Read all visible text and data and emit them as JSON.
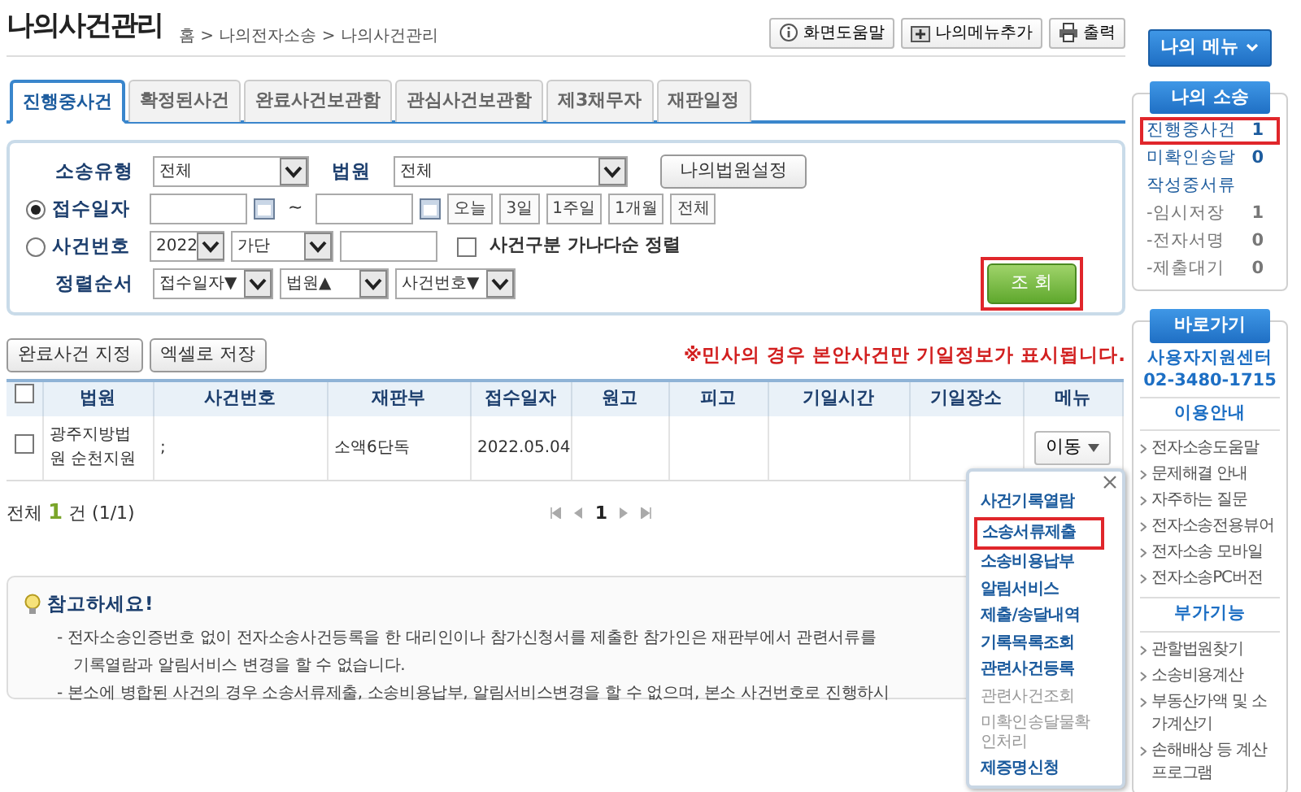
{
  "page": {
    "title": "나의사건관리",
    "breadcrumb": "홈 > 나의전자소송 > 나의사건관리"
  },
  "header_buttons": [
    {
      "kind": "info",
      "label": "화면도움말"
    },
    {
      "kind": "menu-add",
      "label": "나의메뉴추가"
    },
    {
      "kind": "print",
      "label": "출력"
    }
  ],
  "tabs": [
    {
      "label": "진행중사건",
      "selected": true
    },
    {
      "label": "확정된사건",
      "selected": false
    },
    {
      "label": "완료사건보관함",
      "selected": false
    },
    {
      "label": "관심사건보관함",
      "selected": false
    },
    {
      "label": "제3채무자",
      "selected": false
    },
    {
      "label": "재판일정",
      "selected": false
    }
  ],
  "search": {
    "case_type": {
      "label": "소송유형",
      "value": "전체"
    },
    "court": {
      "label": "법원",
      "value": "전체"
    },
    "court_button": "나의법원설정",
    "date_filter": {
      "label": "접수일자",
      "selected": true,
      "separator": "~",
      "quick_buttons": [
        "오늘",
        "3일",
        "1주일",
        "1개월",
        "전체"
      ]
    },
    "case_number_filter": {
      "label": "사건번호",
      "selected": false,
      "year": "2022",
      "case_code": "가단"
    },
    "sort_checkbox": {
      "label": "사건구분 가나다순 정렬",
      "checked": false
    },
    "sort": {
      "label": "정렬순서",
      "options": [
        "접수일자▼",
        "법원▲",
        "사건번호▼"
      ]
    },
    "submit": {
      "label": "조 회",
      "highlighted": true
    }
  },
  "actions": [
    "완료사건 지정",
    "엑셀로 저장"
  ],
  "table_notice": "※민사의 경우 본안사건만 기일정보가 표시됩니다.",
  "table": {
    "columns": [
      "법원",
      "사건번호",
      "재판부",
      "접수일자",
      "원고",
      "피고",
      "기일시간",
      "기일장소",
      "메뉴"
    ],
    "all_checked": false,
    "rows": [
      {
        "checked": false,
        "court": "광주지방법원 순천지원",
        "case_number": ";",
        "division": "소액6단독",
        "received_date": "2022.05.04",
        "menu_button": "이동"
      }
    ]
  },
  "summary": {
    "prefix": "전체",
    "count": "1",
    "suffix": "건 (1/1)"
  },
  "pagination": {
    "pages": [
      {
        "label": "1",
        "selected": true
      }
    ]
  },
  "popup_menu": {
    "items": [
      {
        "label": "사건기록열람",
        "disabled": false,
        "highlighted": false
      },
      {
        "label": "소송서류제출",
        "disabled": false,
        "highlighted": true
      },
      {
        "label": "소송비용납부",
        "disabled": false,
        "highlighted": false
      },
      {
        "label": "알림서비스",
        "disabled": false,
        "highlighted": false
      },
      {
        "label": "제출/송달내역",
        "disabled": false,
        "highlighted": false
      },
      {
        "label": "기록목록조회",
        "disabled": false,
        "highlighted": false
      },
      {
        "label": "관련사건등록",
        "disabled": false,
        "highlighted": false
      },
      {
        "label": "관련사건조회",
        "disabled": true,
        "highlighted": false
      },
      {
        "label": "미확인송달물확인처리",
        "disabled": true,
        "highlighted": false
      },
      {
        "label": "제증명신청",
        "disabled": false,
        "highlighted": false
      }
    ]
  },
  "notice": {
    "title": "참고하세요!",
    "items": [
      {
        "lines": [
          "- 전자소송인증번호 없이 전자소송사건등록을 한 대리인이나 참가신청서를 제출한 참가인은 재판부에서 관련서류를",
          "기록열람과 알림서비스 변경을 할 수 없습니다."
        ]
      },
      {
        "lines": [
          "- 본소에 병합된 사건의 경우 소송서류제출, 소송비용납부, 알림서비스변경을 할 수 없으며, 본소 사건번호로 진행하시"
        ]
      }
    ]
  },
  "sidebar": {
    "menu_button": "나의 메뉴",
    "my_cases": {
      "title": "나의 소송",
      "items": [
        {
          "label": "진행중사건",
          "count": "1",
          "highlighted": true,
          "kind": "main"
        },
        {
          "label": "미확인송달",
          "count": "0",
          "highlighted": false,
          "kind": "main"
        },
        {
          "label": "작성중서류",
          "highlighted": false,
          "kind": "main"
        },
        {
          "label": "-임시저장",
          "count": "1",
          "highlighted": false,
          "kind": "sub"
        },
        {
          "label": "-전자서명",
          "count": "0",
          "highlighted": false,
          "kind": "sub"
        },
        {
          "label": "-제출대기",
          "count": "0",
          "highlighted": false,
          "kind": "sub"
        }
      ]
    },
    "shortcuts": {
      "title": "바로가기",
      "support_title": "사용자지원센터",
      "support_phone": "02-3480-1715",
      "sections": [
        {
          "title": "이용안내",
          "links": [
            "전자소송도움말",
            "문제해결 안내",
            "자주하는 질문",
            "전자소송전용뷰어",
            "전자소송 모바일",
            "전자소송PC버전"
          ]
        },
        {
          "title": "부가기능",
          "links": [
            "관할법원찾기",
            "소송비용계산",
            "부동산가액 및 소가계산기",
            "손해배상 등 계산 프로그램"
          ]
        }
      ]
    }
  }
}
